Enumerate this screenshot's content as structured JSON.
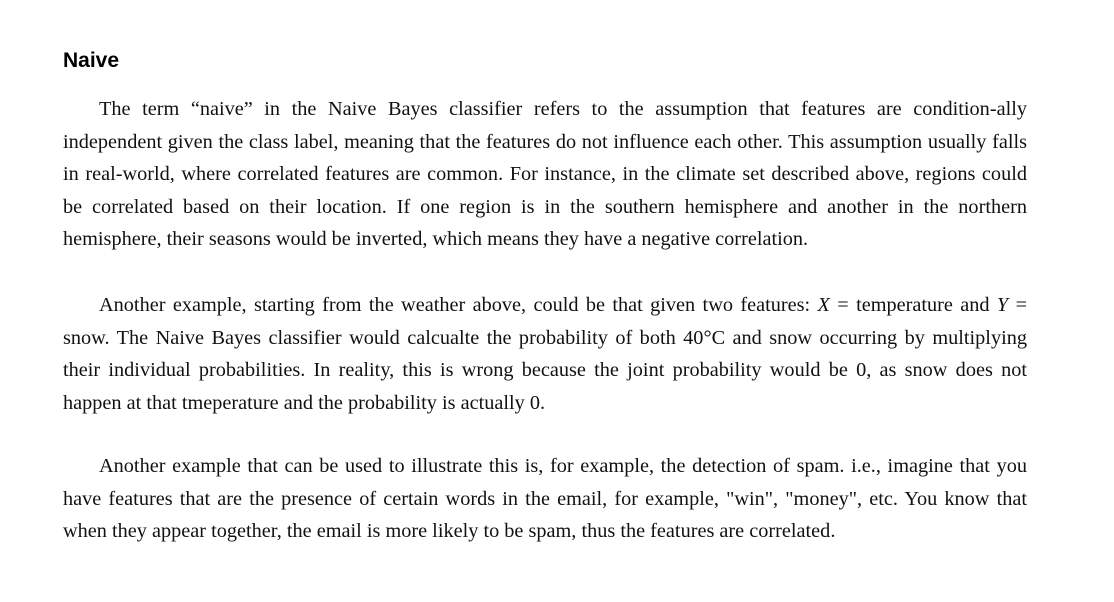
{
  "section": {
    "title": "Naive"
  },
  "paragraphs": [
    {
      "text": "The term “naive” in the Naive Bayes classifier refers to the assumption that features are condition-ally independent given the class label, meaning that the features do not influence each other. This assumption usually falls in real-world, where correlated features are common. For instance, in the climate set described above, regions could be correlated based on their location. If one region is in the southern hemisphere and another in the northern hemisphere, their seasons would be inverted, which means they have a negative correlation."
    },
    {
      "before_x": "Another example, starting from the weather above, could be that given two features: ",
      "var_x": "X",
      "eq_x": " = temperature and ",
      "var_y": "Y",
      "after_y": " = snow. The Naive Bayes classifier would calcualte the probability of both 40°C and snow occurring by multiplying their individual probabilities. In reality, this is wrong because the joint probability would be 0, as snow does not happen at that tmeperature and the probability is actually 0."
    },
    {
      "text": "Another example that can be used to illustrate this is, for example, the detection of spam. i.e., imagine that you have features that are the presence of certain words in the email, for example, \"win\", \"money\", etc. You know that when they appear together, the email is more likely to be spam, thus the features are correlated."
    }
  ]
}
